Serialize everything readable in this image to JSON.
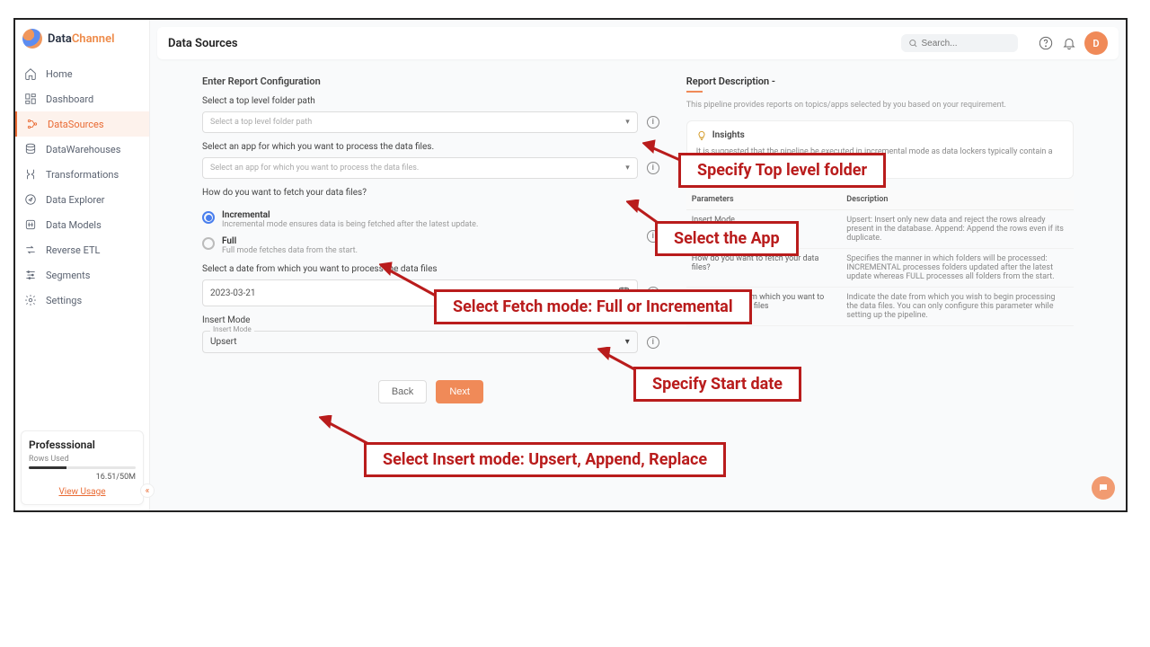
{
  "brand": {
    "prefix": "Data",
    "suffix": "Channel"
  },
  "nav": {
    "items": [
      {
        "label": "Home"
      },
      {
        "label": "Dashboard"
      },
      {
        "label": "DataSources"
      },
      {
        "label": "DataWarehouses"
      },
      {
        "label": "Transformations"
      },
      {
        "label": "Data Explorer"
      },
      {
        "label": "Data Models"
      },
      {
        "label": "Reverse ETL"
      },
      {
        "label": "Segments"
      },
      {
        "label": "Settings"
      }
    ]
  },
  "plan": {
    "title": "Professsional",
    "rows_label": "Rows Used",
    "usage": "16.51/50M",
    "link": "View Usage"
  },
  "header": {
    "title": "Data Sources",
    "search_placeholder": "Search...",
    "avatar_initial": "D"
  },
  "form": {
    "heading": "Enter Report Configuration",
    "folder_label": "Select a top level folder path",
    "folder_placeholder": "Select a top level folder path",
    "app_label": "Select an app for which you want to process the data files.",
    "app_placeholder": "Select an app for which you want to process the data files.",
    "fetch_label": "How do you want to fetch your data files?",
    "fetch_incremental_title": "Incremental",
    "fetch_incremental_sub": "Incremental mode ensures data is being fetched after the latest update.",
    "fetch_full_title": "Full",
    "fetch_full_sub": "Full mode fetches data from the start.",
    "date_label": "Select a date from which you want to process the data files",
    "date_value": "2023-03-21",
    "insert_mode_label": "Insert Mode",
    "insert_mode_legend": "Insert Mode",
    "insert_mode_value": "Upsert",
    "back_label": "Back",
    "next_label": "Next"
  },
  "desc": {
    "title": "Report Description -",
    "p1": "This pipeline provides reports on topics/apps selected by you based on your requirement.",
    "insight_title": "Insights",
    "insight_p": "It is suggested that the pipeline be executed in incremental mode as data lockers typically contain a large amount of data.",
    "table": {
      "h1": "Parameters",
      "h2": "Description",
      "rows": [
        {
          "p": "Insert Mode",
          "d": "Upsert: Insert only new data and reject the rows already present in the database. Append: Append the rows even if its duplicate."
        },
        {
          "p": "How do you want to fetch your data files?",
          "d": "Specifies the manner in which folders will be processed: INCREMENTAL processes folders updated after the latest update whereas FULL processes all folders from the start."
        },
        {
          "p": "Select a date from which you want to process the data files",
          "d": "Indicate the date from which you wish to begin processing the data files. You can only configure this parameter while setting up the pipeline."
        }
      ]
    }
  },
  "callouts": {
    "folder": "Specify Top level folder",
    "app": "Select the App",
    "fetch": "Select Fetch mode: Full or Incremental",
    "date": "Specify Start date",
    "insert": "Select Insert mode: Upsert, Append, Replace"
  }
}
